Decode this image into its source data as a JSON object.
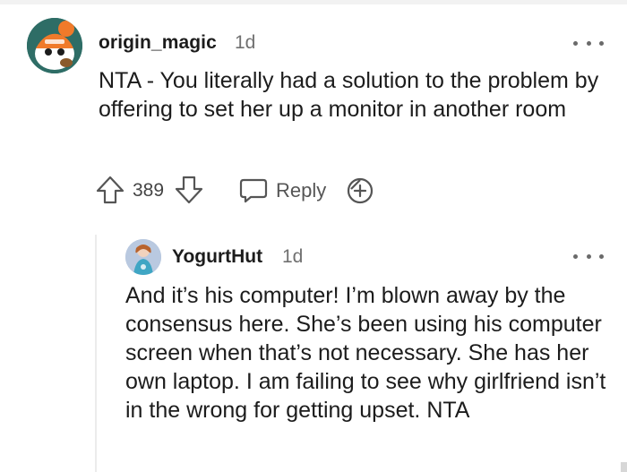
{
  "comments": [
    {
      "username": "origin_magic",
      "time": "1d",
      "body": "NTA - You literally had a solution to the problem by offering to set her up a monitor in another room",
      "score": "389",
      "reply_label": "Reply",
      "avatar_icon": "snoo-avatar-orange",
      "more_icon": "more-options-icon"
    },
    {
      "username": "YogurtHut",
      "time": "1d",
      "body": "And it’s his computer! I’m blown away by the consensus here. She’s been using his computer screen when that’s not necessary. She has her own laptop. I am failing to see why girlfriend isn’t in the wrong for getting upset. NTA",
      "avatar_icon": "snoo-avatar-blue",
      "more_icon": "more-options-icon"
    }
  ],
  "colors": {
    "text": "#1c1c1c",
    "meta": "#707070",
    "icon": "#6a6a6a",
    "thread_line": "#ececec"
  }
}
